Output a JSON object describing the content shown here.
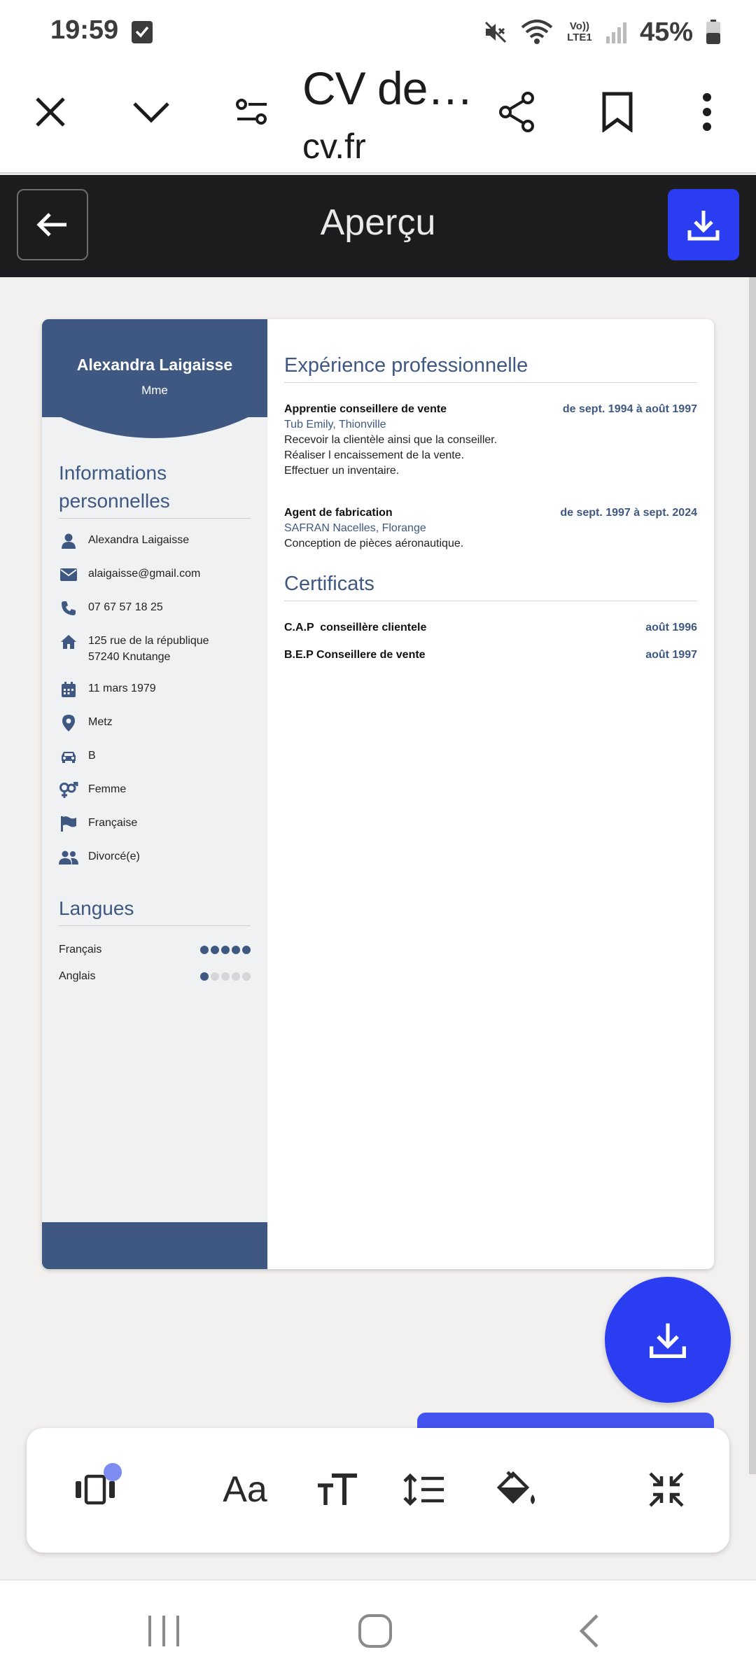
{
  "status_bar": {
    "time": "19:59",
    "network": "Vo)) LTE1",
    "battery": "45%"
  },
  "browser": {
    "page_title": "CV de…",
    "url": "cv.fr"
  },
  "app_header": {
    "title": "Aperçu"
  },
  "cv": {
    "name": "Alexandra Laigaisse",
    "civility": "Mme",
    "info_heading": "Informations personnelles",
    "info": [
      {
        "icon": "person-icon",
        "text": "Alexandra Laigaisse"
      },
      {
        "icon": "email-icon",
        "text": "alaigaisse@gmail.com"
      },
      {
        "icon": "phone-icon",
        "text": "07 67 57 18 25"
      },
      {
        "icon": "home-icon",
        "text": "125 rue de la république",
        "text2": "57240 Knutange"
      },
      {
        "icon": "calendar-icon",
        "text": "11 mars 1979"
      },
      {
        "icon": "location-pin-icon",
        "text": "Metz"
      },
      {
        "icon": "car-icon",
        "text": "B"
      },
      {
        "icon": "gender-icon",
        "text": "Femme"
      },
      {
        "icon": "flag-icon",
        "text": "Française"
      },
      {
        "icon": "people-icon",
        "text": "Divorcé(e)"
      }
    ],
    "languages_heading": "Langues",
    "languages": [
      {
        "name": "Français",
        "level": 5,
        "max": 5
      },
      {
        "name": "Anglais",
        "level": 1,
        "max": 5
      }
    ],
    "experience_heading": "Expérience professionnelle",
    "experience": [
      {
        "title": "Apprentie conseillere de vente",
        "dates": "de sept. 1994 à août 1997",
        "company": "Tub Emily, Thionville",
        "lines": [
          "Recevoir la clientèle ainsi que la conseiller.",
          "Réaliser l encaissement de la vente.",
          "Effectuer un inventaire."
        ]
      },
      {
        "title": "Agent de fabrication",
        "dates": "de sept. 1997 à sept. 2024",
        "company": "SAFRAN Nacelles, Florange",
        "lines": [
          "Conception de pièces aéronautique."
        ]
      }
    ],
    "certificates_heading": "Certificats",
    "certificates": [
      {
        "title": "C.A.P  conseillère clientele",
        "date": "août 1996"
      },
      {
        "title": "B.E.P Conseillere de vente",
        "date": "août 1997"
      }
    ]
  },
  "colors": {
    "accent": "#2b3df0",
    "cv_primary": "#3f5881",
    "header_bg": "#1c1c1e"
  }
}
